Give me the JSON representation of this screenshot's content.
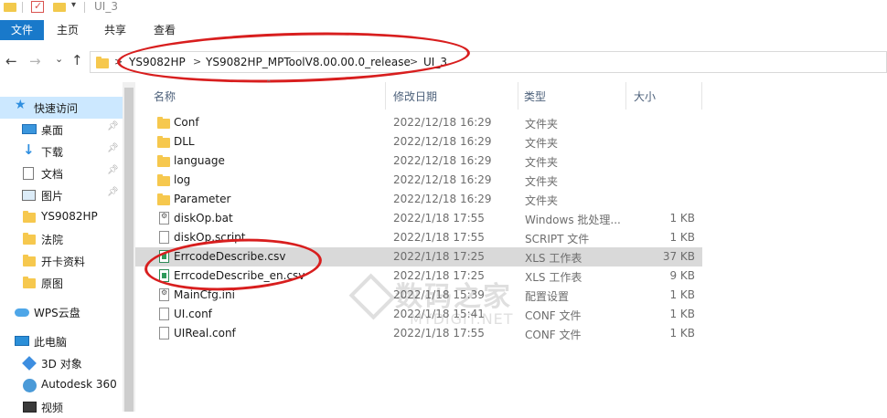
{
  "window": {
    "title": "UI_3"
  },
  "ribbon": {
    "tabs": [
      "文件",
      "主页",
      "共享",
      "查看"
    ]
  },
  "nav": {
    "back": "←",
    "forward": "→",
    "recent": "⌄",
    "up": "↑",
    "separator": ">"
  },
  "address": {
    "crumbs": [
      "YS9082HP",
      "YS9082HP_MPToolV8.00.00.0_release",
      "UI_3"
    ]
  },
  "sidebar": {
    "items": [
      {
        "label": "快速访问",
        "icon": "star-icon",
        "selected": true
      },
      {
        "label": "桌面",
        "icon": "desktop-icon",
        "pinned": true
      },
      {
        "label": "下载",
        "icon": "download-icon",
        "pinned": true
      },
      {
        "label": "文档",
        "icon": "document-icon",
        "pinned": true
      },
      {
        "label": "图片",
        "icon": "pictures-icon",
        "pinned": true
      },
      {
        "label": "YS9082HP",
        "icon": "folder-icon"
      },
      {
        "label": "法院",
        "icon": "folder-icon"
      },
      {
        "label": "开卡资料",
        "icon": "folder-icon"
      },
      {
        "label": "原图",
        "icon": "folder-icon"
      },
      {
        "label": "WPS云盘",
        "icon": "cloud-icon"
      },
      {
        "label": "此电脑",
        "icon": "computer-icon"
      },
      {
        "label": "3D 对象",
        "icon": "3d-objects-icon"
      },
      {
        "label": "Autodesk 360",
        "icon": "autodesk-icon"
      },
      {
        "label": "视频",
        "icon": "video-icon"
      }
    ]
  },
  "columns": {
    "name": "名称",
    "modified": "修改日期",
    "type": "类型",
    "size": "大小"
  },
  "files": [
    {
      "name": "Conf",
      "modified": "2022/12/18 16:29",
      "type": "文件夹",
      "size": "",
      "icon": "folder-icon"
    },
    {
      "name": "DLL",
      "modified": "2022/12/18 16:29",
      "type": "文件夹",
      "size": "",
      "icon": "folder-icon"
    },
    {
      "name": "language",
      "modified": "2022/12/18 16:29",
      "type": "文件夹",
      "size": "",
      "icon": "folder-icon"
    },
    {
      "name": "log",
      "modified": "2022/12/18 16:29",
      "type": "文件夹",
      "size": "",
      "icon": "folder-icon"
    },
    {
      "name": "Parameter",
      "modified": "2022/12/18 16:29",
      "type": "文件夹",
      "size": "",
      "icon": "folder-icon"
    },
    {
      "name": "diskOp.bat",
      "modified": "2022/1/18 17:55",
      "type": "Windows 批处理...",
      "size": "1 KB",
      "icon": "batch-file-icon"
    },
    {
      "name": "diskOp.script",
      "modified": "2022/1/18 17:55",
      "type": "SCRIPT 文件",
      "size": "1 KB",
      "icon": "file-icon"
    },
    {
      "name": "ErrcodeDescribe.csv",
      "modified": "2022/1/18 17:25",
      "type": "XLS 工作表",
      "size": "37 KB",
      "icon": "spreadsheet-icon",
      "selected": true
    },
    {
      "name": "ErrcodeDescribe_en.csv",
      "modified": "2022/1/18 17:25",
      "type": "XLS 工作表",
      "size": "9 KB",
      "icon": "spreadsheet-icon"
    },
    {
      "name": "MainCfg.ini",
      "modified": "2022/1/18 15:39",
      "type": "配置设置",
      "size": "1 KB",
      "icon": "settings-file-icon"
    },
    {
      "name": "UI.conf",
      "modified": "2022/1/18 15:41",
      "type": "CONF 文件",
      "size": "1 KB",
      "icon": "file-icon"
    },
    {
      "name": "UIReal.conf",
      "modified": "2022/1/18 17:55",
      "type": "CONF 文件",
      "size": "1 KB",
      "icon": "file-icon"
    }
  ],
  "watermark": {
    "text": "数码之家",
    "url": "MYDIGIT.NET"
  },
  "colors": {
    "accent": "#1979ca",
    "selection": "#cce8ff",
    "row_selected": "#d9d9d9",
    "annotation": "#d81e1e"
  }
}
